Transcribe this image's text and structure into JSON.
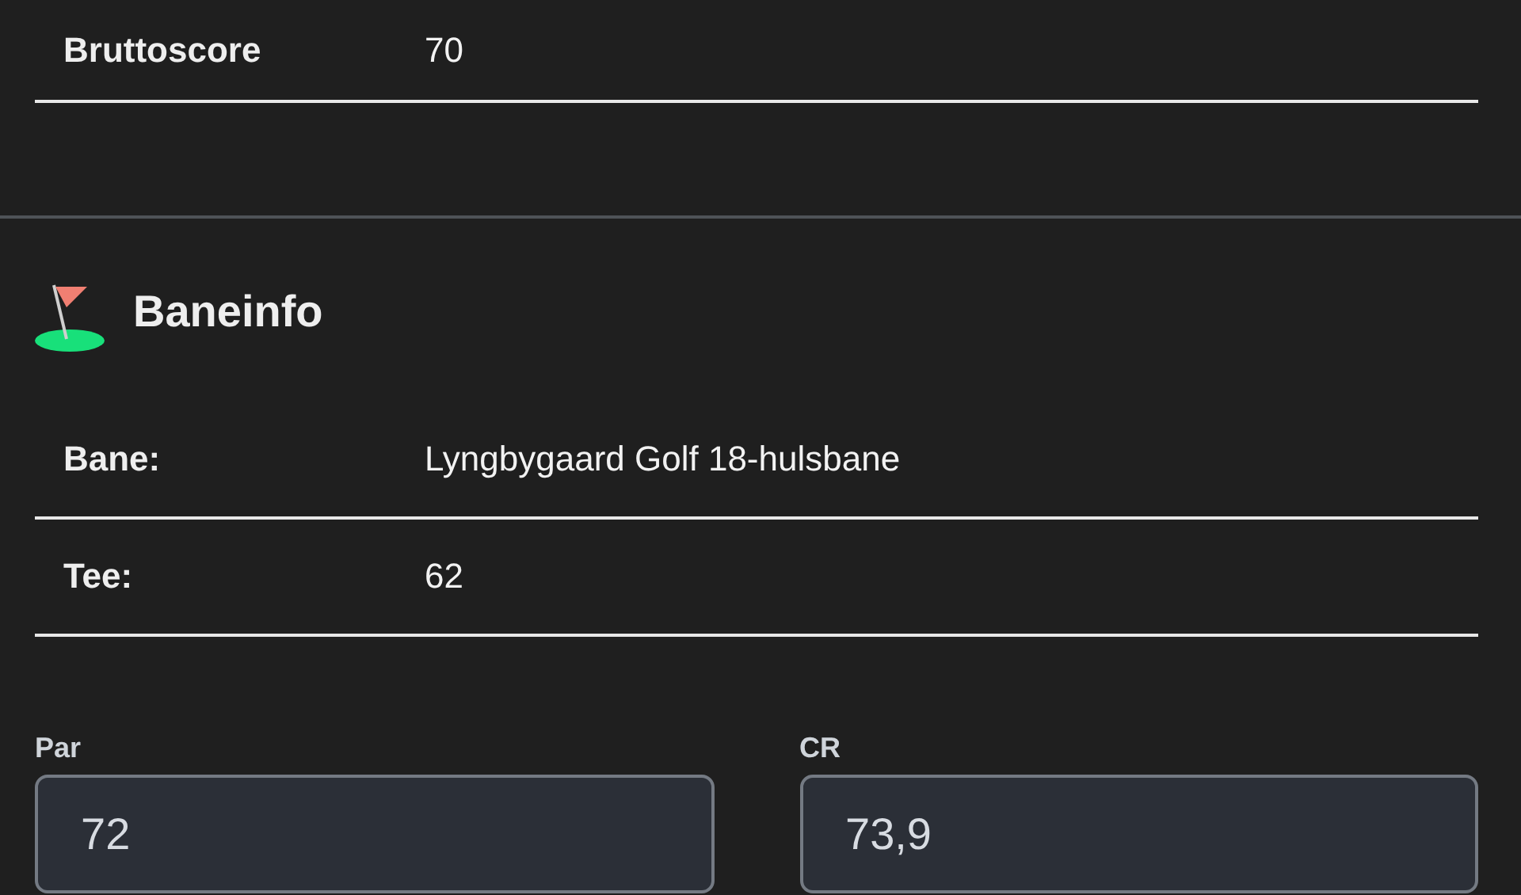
{
  "score_rows": [
    {
      "label": "Bruttoscore",
      "value": "70"
    }
  ],
  "course_section": {
    "title": "Baneinfo",
    "rows": [
      {
        "label": "Bane:",
        "value": "Lyngbygaard Golf 18-hulsbane"
      },
      {
        "label": "Tee:",
        "value": "62"
      }
    ],
    "fields": [
      {
        "label": "Par",
        "value": "72"
      },
      {
        "label": "CR",
        "value": "73,9"
      }
    ]
  }
}
